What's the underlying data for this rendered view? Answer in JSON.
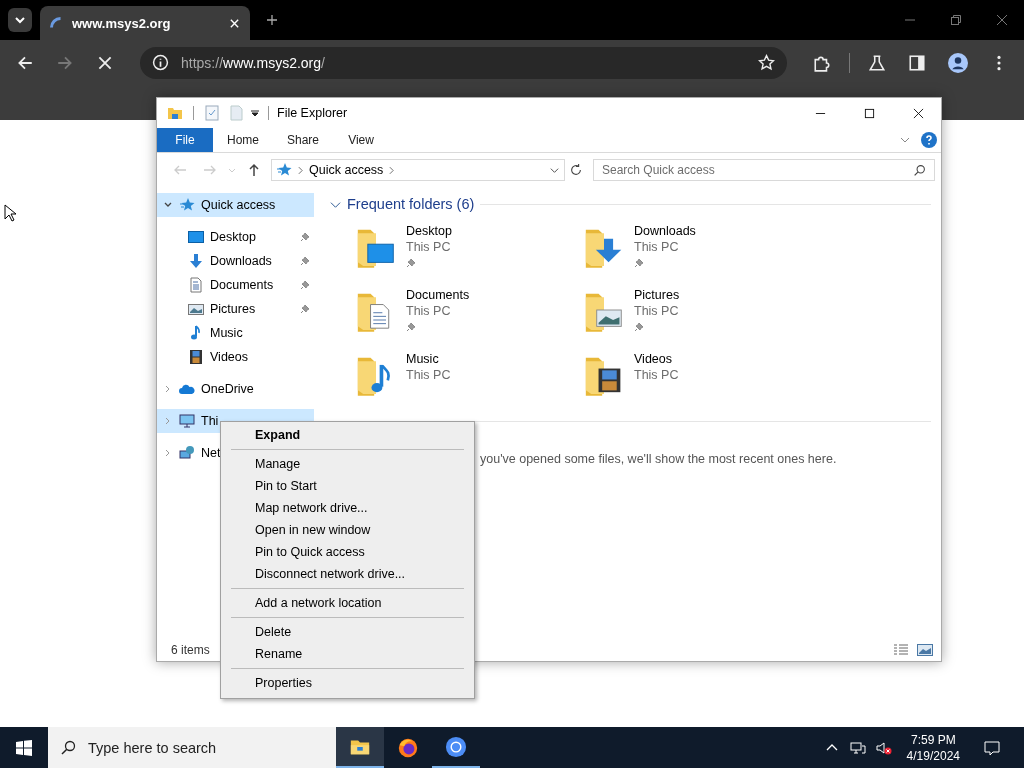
{
  "browser": {
    "tab": {
      "title": "www.msys2.org",
      "loading": true
    },
    "url": {
      "scheme": "https://",
      "host": "www.msys2.org",
      "path": "/"
    }
  },
  "explorer": {
    "title": "File Explorer",
    "ribbon_tabs": [
      {
        "label": "File",
        "selected": true
      },
      {
        "label": "Home",
        "selected": false
      },
      {
        "label": "Share",
        "selected": false
      },
      {
        "label": "View",
        "selected": false
      }
    ],
    "address": {
      "crumbs": [
        "Quick access"
      ]
    },
    "search": {
      "placeholder": "Search Quick access"
    },
    "nav": [
      {
        "label": "Quick access",
        "kind": "star",
        "expanded": true,
        "selected": true,
        "children": [
          {
            "label": "Desktop",
            "kind": "desktop",
            "pinned": true
          },
          {
            "label": "Downloads",
            "kind": "downloads",
            "pinned": true
          },
          {
            "label": "Documents",
            "kind": "documents",
            "pinned": true
          },
          {
            "label": "Pictures",
            "kind": "pictures",
            "pinned": true
          },
          {
            "label": "Music",
            "kind": "music",
            "pinned": false
          },
          {
            "label": "Videos",
            "kind": "videos",
            "pinned": false
          }
        ]
      },
      {
        "label": "OneDrive",
        "kind": "cloud",
        "expanded": false,
        "selected": false
      },
      {
        "label": "Thi",
        "kind": "pc",
        "expanded": false,
        "selected": true
      },
      {
        "label": "Net",
        "kind": "network",
        "expanded": false,
        "selected": false
      }
    ],
    "frequent": {
      "title": "Frequent folders (6)",
      "expanded": true,
      "folders": [
        {
          "name": "Desktop",
          "location": "This PC",
          "kind": "desktop",
          "pinned": true
        },
        {
          "name": "Downloads",
          "location": "This PC",
          "kind": "downloads",
          "pinned": true
        },
        {
          "name": "Documents",
          "location": "This PC",
          "kind": "documents",
          "pinned": true
        },
        {
          "name": "Pictures",
          "location": "This PC",
          "kind": "pictures",
          "pinned": true
        },
        {
          "name": "Music",
          "location": "This PC",
          "kind": "music",
          "pinned": false
        },
        {
          "name": "Videos",
          "location": "This PC",
          "kind": "videos",
          "pinned": false
        }
      ]
    },
    "recent": {
      "message": "you've opened some files, we'll show the most recent ones here."
    },
    "status": {
      "count": "6 items"
    }
  },
  "context_menu": {
    "groups": [
      [
        {
          "label": "Expand",
          "default": true
        }
      ],
      [
        {
          "label": "Manage",
          "default": false
        },
        {
          "label": "Pin to Start",
          "default": false
        },
        {
          "label": "Map network drive...",
          "default": false
        },
        {
          "label": "Open in new window",
          "default": false
        },
        {
          "label": "Pin to Quick access",
          "default": false
        },
        {
          "label": "Disconnect network drive...",
          "default": false
        }
      ],
      [
        {
          "label": "Add a network location",
          "default": false
        }
      ],
      [
        {
          "label": "Delete",
          "default": false
        },
        {
          "label": "Rename",
          "default": false
        }
      ],
      [
        {
          "label": "Properties",
          "default": false
        }
      ]
    ]
  },
  "taskbar": {
    "search": {
      "placeholder": "Type here to search"
    },
    "apps": [
      {
        "kind": "explorer",
        "running": true,
        "active": true
      },
      {
        "kind": "firefox",
        "running": false,
        "active": false
      },
      {
        "kind": "chrome",
        "running": true,
        "active": false
      }
    ],
    "time": "7:59 PM",
    "date": "4/19/2024"
  }
}
